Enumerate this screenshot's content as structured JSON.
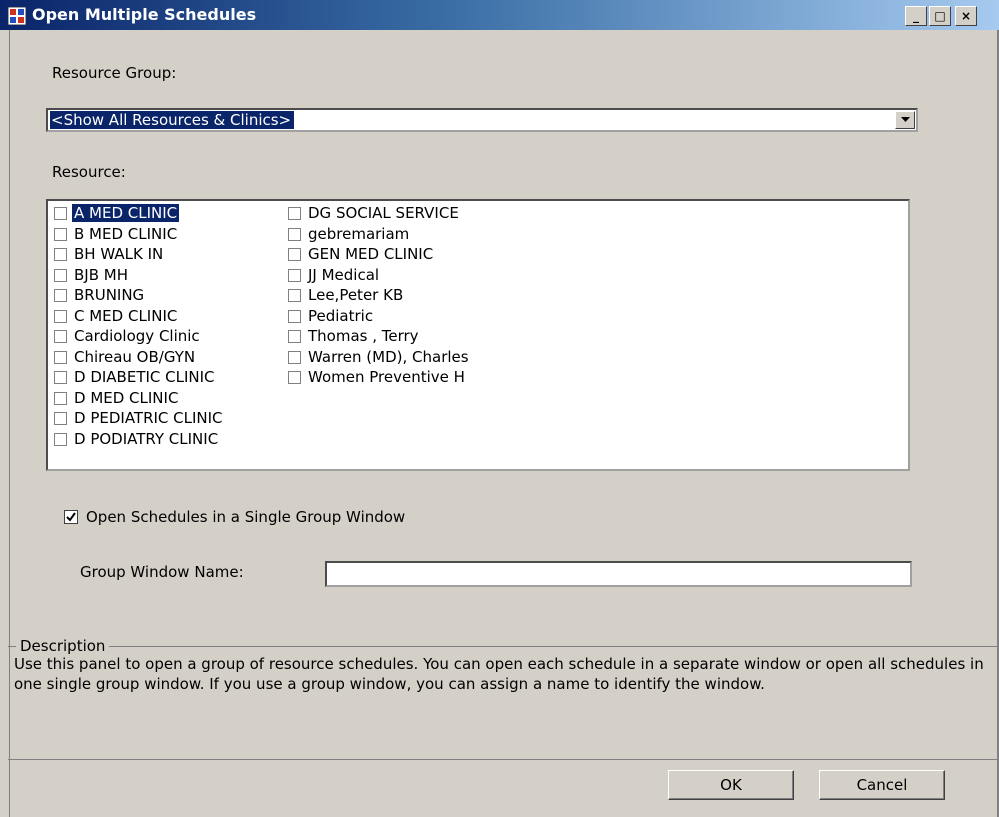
{
  "window": {
    "title": "Open Multiple Schedules",
    "minimize_glyph": "_",
    "maximize_glyph": "□",
    "close_glyph": "×"
  },
  "resource_group": {
    "label": "Resource Group:",
    "selected": "<Show All Resources & Clinics>"
  },
  "resource": {
    "label": "Resource:",
    "column1": [
      {
        "label": "A MED CLINIC",
        "checked": false,
        "selected": true
      },
      {
        "label": "B MED CLINIC",
        "checked": false
      },
      {
        "label": "BH WALK IN",
        "checked": false
      },
      {
        "label": "BJB MH",
        "checked": false
      },
      {
        "label": "BRUNING",
        "checked": false
      },
      {
        "label": "C MED CLINIC",
        "checked": false
      },
      {
        "label": "Cardiology Clinic",
        "checked": false
      },
      {
        "label": "Chireau OB/GYN",
        "checked": false
      },
      {
        "label": "D DIABETIC CLINIC",
        "checked": false
      },
      {
        "label": "D MED CLINIC",
        "checked": false
      },
      {
        "label": "D PEDIATRIC CLINIC",
        "checked": false
      },
      {
        "label": "D PODIATRY CLINIC",
        "checked": false
      }
    ],
    "column2": [
      {
        "label": "DG SOCIAL SERVICE",
        "checked": false
      },
      {
        "label": "gebremariam",
        "checked": false
      },
      {
        "label": "GEN MED CLINIC",
        "checked": false
      },
      {
        "label": "JJ Medical",
        "checked": false
      },
      {
        "label": "Lee,Peter KB",
        "checked": false
      },
      {
        "label": "Pediatric",
        "checked": false
      },
      {
        "label": "Thomas , Terry",
        "checked": false
      },
      {
        "label": "Warren (MD), Charles",
        "checked": false
      },
      {
        "label": "Women Preventive H",
        "checked": false
      }
    ]
  },
  "single_group": {
    "label": "Open Schedules in a Single Group Window",
    "checked": true
  },
  "group_window_name": {
    "label": "Group Window Name:",
    "value": ""
  },
  "description": {
    "legend": "Description",
    "text": "Use this panel to open a group of resource schedules.  You can open each schedule in a separate window or open all schedules in one single group window.  If you use a group window, you can assign a name to identify the window."
  },
  "buttons": {
    "ok": "OK",
    "cancel": "Cancel"
  },
  "colors": {
    "title_bar": "#0a246a",
    "dialog_bg": "#d4d0c8",
    "selection": "#0a246a"
  }
}
